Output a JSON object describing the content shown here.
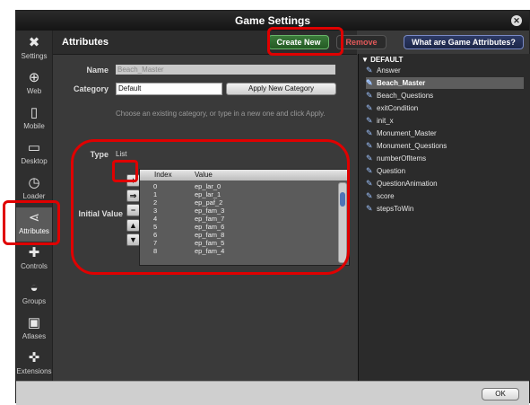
{
  "window": {
    "title": "Game Settings"
  },
  "sidebar": {
    "items": [
      {
        "label": "Settings",
        "icon": "tools-icon"
      },
      {
        "label": "Web",
        "icon": "globe-icon"
      },
      {
        "label": "Mobile",
        "icon": "phone-icon"
      },
      {
        "label": "Desktop",
        "icon": "monitor-icon"
      },
      {
        "label": "Loader",
        "icon": "clock-icon"
      },
      {
        "label": "Attributes",
        "icon": "share-icon"
      },
      {
        "label": "Controls",
        "icon": "gamepad-icon"
      },
      {
        "label": "Groups",
        "icon": "car-icon"
      },
      {
        "label": "Atlases",
        "icon": "image-icon"
      },
      {
        "label": "Extensions",
        "icon": "puzzle-icon"
      }
    ],
    "active": "Attributes"
  },
  "toolbar": {
    "title": "Attributes",
    "create_label": "Create New",
    "remove_label": "Remove",
    "what_label": "What are Game Attributes?"
  },
  "form": {
    "name_label": "Name",
    "name_value": "Beach_Master",
    "category_label": "Category",
    "category_value": "Default",
    "apply_label": "Apply New Category",
    "hint": "Choose an existing category, or type in a new one and click Apply.",
    "type_label": "Type",
    "type_value": "List",
    "initial_label": "Initial Value"
  },
  "table": {
    "headers": [
      "Index",
      "Value"
    ],
    "rows": [
      {
        "index": "0",
        "value": "ep_lar_0"
      },
      {
        "index": "1",
        "value": "ep_lar_1"
      },
      {
        "index": "2",
        "value": "ep_paf_2"
      },
      {
        "index": "3",
        "value": "ep_fam_3"
      },
      {
        "index": "4",
        "value": "ep_fam_7"
      },
      {
        "index": "5",
        "value": "ep_fam_6"
      },
      {
        "index": "6",
        "value": "ep_fam_8"
      },
      {
        "index": "7",
        "value": "ep_fam_5"
      },
      {
        "index": "8",
        "value": "ep_fam_4"
      }
    ]
  },
  "tree": {
    "category": "▼ DEFAULT",
    "items": [
      "Answer",
      "Beach_Master",
      "Beach_Questions",
      "exitCondition",
      "init_x",
      "Monument_Master",
      "Monument_Questions",
      "numberOfItems",
      "Question",
      "QuestionAnimation",
      "score",
      "stepsToWin"
    ],
    "selected": "Beach_Master"
  },
  "footer": {
    "ok_label": "OK"
  },
  "colors": {
    "highlight": "#e00000",
    "accent_green": "#3a7a3a",
    "selected_row": "#5d5d5d"
  }
}
